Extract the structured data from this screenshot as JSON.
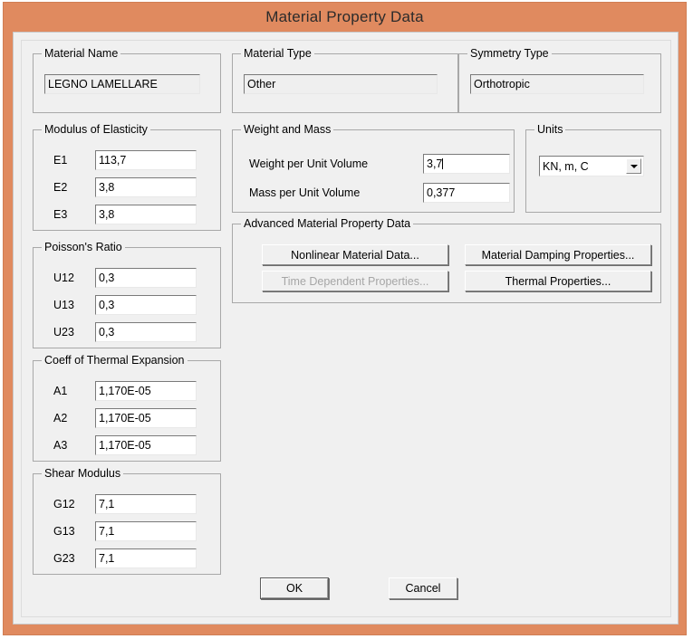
{
  "window": {
    "title": "Material Property Data",
    "title_bar_color": "#e08a5f",
    "dialog_face_color": "#f0f0f0"
  },
  "material_name": {
    "group_title": "Material Name",
    "value": "LEGNO LAMELLARE"
  },
  "material_type": {
    "group_title": "Material Type",
    "value": "Other"
  },
  "symmetry_type": {
    "group_title": "Symmetry Type",
    "value": "Orthotropic"
  },
  "modulus_of_elasticity": {
    "group_title": "Modulus of Elasticity",
    "rows": [
      {
        "label": "E1",
        "value": "113,7"
      },
      {
        "label": "E2",
        "value": "3,8"
      },
      {
        "label": "E3",
        "value": "3,8"
      }
    ]
  },
  "weight_and_mass": {
    "group_title": "Weight and Mass",
    "rows": [
      {
        "label": "Weight per Unit Volume",
        "value": "3,7"
      },
      {
        "label": "Mass per Unit Volume",
        "value": "0,377"
      }
    ]
  },
  "units": {
    "group_title": "Units",
    "selected": "KN, m, C"
  },
  "advanced": {
    "group_title": "Advanced Material Property Data",
    "buttons": [
      {
        "label": "Nonlinear Material Data...",
        "disabled": false
      },
      {
        "label": "Material Damping Properties...",
        "disabled": false
      },
      {
        "label": "Time Dependent Properties...",
        "disabled": true
      },
      {
        "label": "Thermal Properties...",
        "disabled": false
      }
    ]
  },
  "poissons_ratio": {
    "group_title": "Poisson's Ratio",
    "rows": [
      {
        "label": "U12",
        "value": "0,3"
      },
      {
        "label": "U13",
        "value": "0,3"
      },
      {
        "label": "U23",
        "value": "0,3"
      }
    ]
  },
  "thermal_expansion": {
    "group_title": "Coeff of Thermal Expansion",
    "rows": [
      {
        "label": "A1",
        "value": "1,170E-05"
      },
      {
        "label": "A2",
        "value": "1,170E-05"
      },
      {
        "label": "A3",
        "value": "1,170E-05"
      }
    ]
  },
  "shear_modulus": {
    "group_title": "Shear Modulus",
    "rows": [
      {
        "label": "G12",
        "value": "7,1"
      },
      {
        "label": "G13",
        "value": "7,1"
      },
      {
        "label": "G23",
        "value": "7,1"
      }
    ]
  },
  "footer": {
    "ok_label": "OK",
    "cancel_label": "Cancel"
  }
}
